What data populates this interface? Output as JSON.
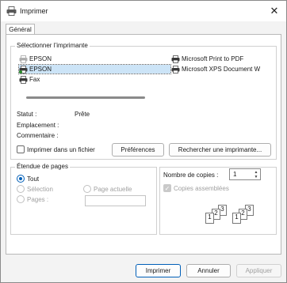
{
  "window": {
    "title": "Imprimer",
    "close_glyph": "✕"
  },
  "tabs": [
    {
      "label": "Général"
    }
  ],
  "select_printer": {
    "title": "Sélectionner l’imprimante",
    "printers": [
      {
        "name": "EPSON",
        "icon": "printer-offline-icon"
      },
      {
        "name": "EPSON",
        "icon": "printer-default-icon",
        "selected": true
      },
      {
        "name": "Fax",
        "icon": "fax-icon"
      },
      {
        "name": "Microsoft Print to PDF",
        "icon": "printer-icon"
      },
      {
        "name": "Microsoft XPS Document W",
        "icon": "printer-icon"
      }
    ],
    "status_label": "Statut :",
    "status_value": "Prête",
    "location_label": "Emplacement :",
    "comment_label": "Commentaire :",
    "print_to_file_label": "Imprimer dans un fichier",
    "preferences_button": "Préférences",
    "find_printer_button": "Rechercher une imprimante..."
  },
  "page_range": {
    "title": "Étendue de pages",
    "all_label": "Tout",
    "selection_label": "Sélection",
    "current_page_label": "Page actuelle",
    "pages_label": "Pages :",
    "pages_value": ""
  },
  "copies": {
    "label": "Nombre de copies :",
    "value": "1",
    "collate_label": "Copies assemblées",
    "collate_checked": true,
    "stack_labels": [
      "1",
      "2",
      "3"
    ]
  },
  "footer": {
    "print_button": "Imprimer",
    "cancel_button": "Annuler",
    "apply_button": "Appliquer"
  },
  "colors": {
    "accent": "#005fb8",
    "selection": "#cce4f7"
  }
}
